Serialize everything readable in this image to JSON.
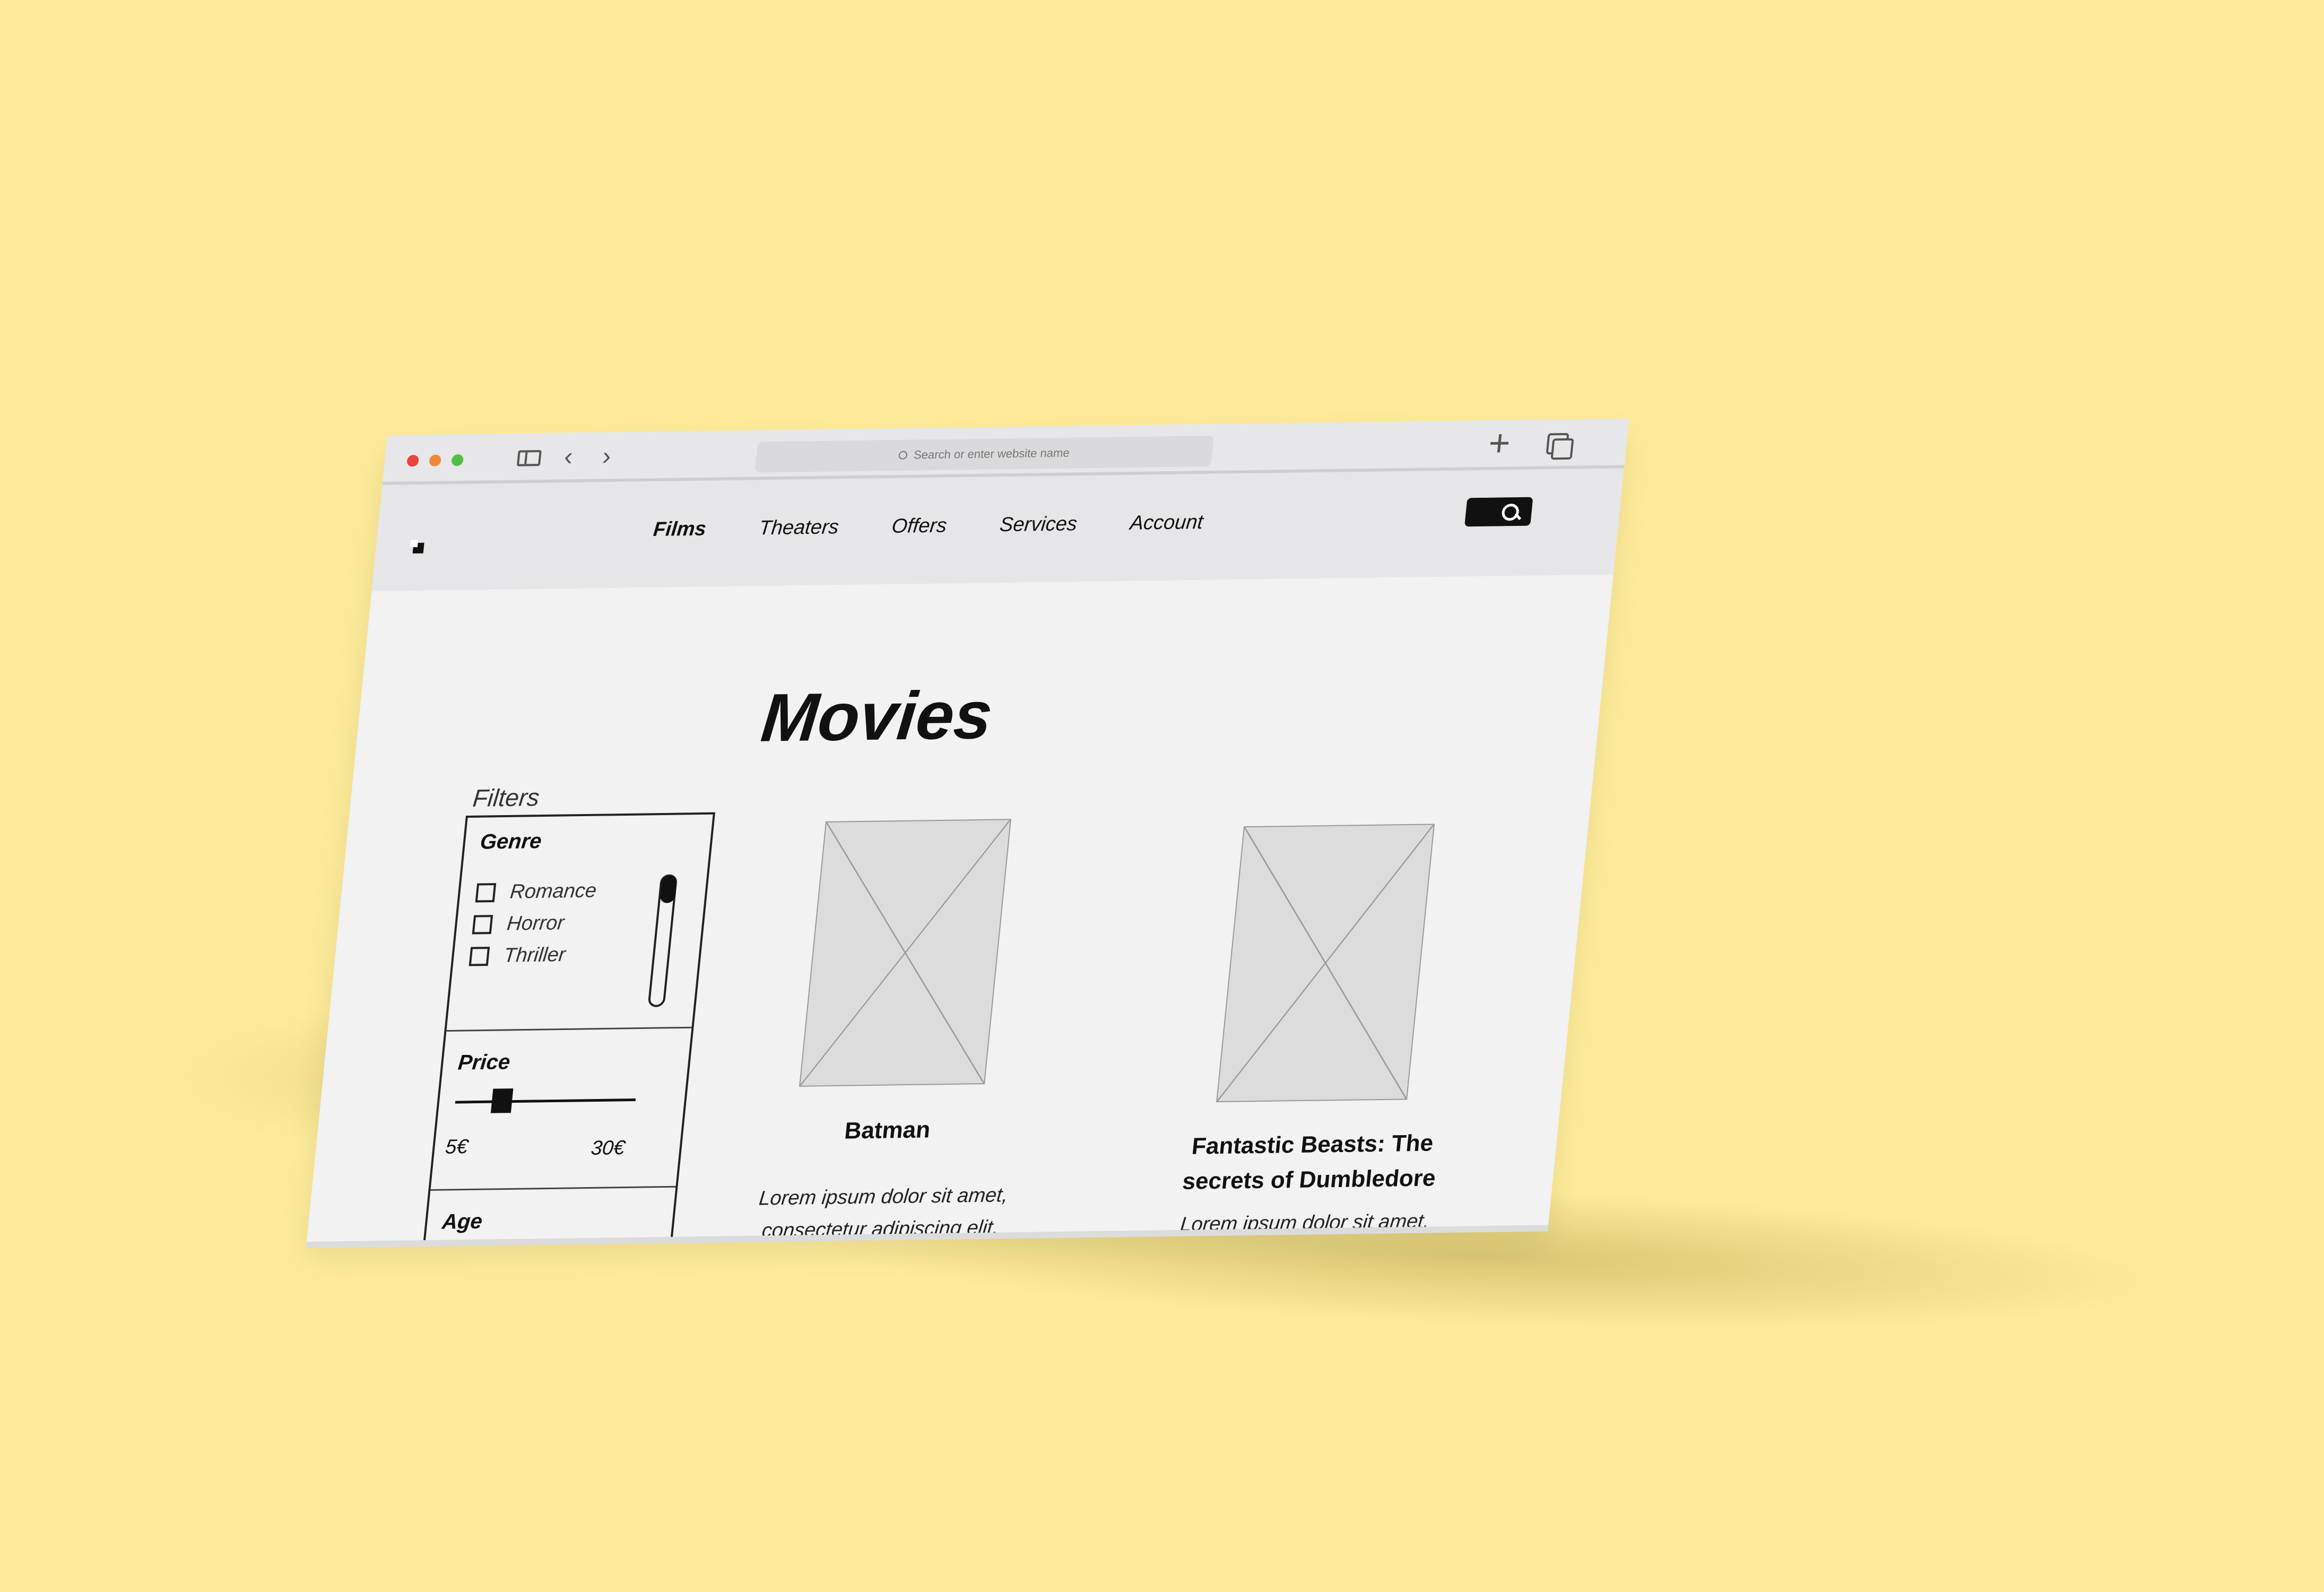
{
  "browser": {
    "address_placeholder": "Search or enter website name"
  },
  "site": {
    "nav": [
      "Films",
      "Theaters",
      "Offers",
      "Services",
      "Account"
    ],
    "active_nav": "Films"
  },
  "page": {
    "title": "Movies"
  },
  "filters": {
    "label": "Filters",
    "genre": {
      "heading": "Genre",
      "options": [
        "Romance",
        "Horror",
        "Thriller"
      ]
    },
    "price": {
      "heading": "Price",
      "min_label": "5€",
      "max_label": "30€",
      "handle_fraction": 0.2
    },
    "age": {
      "heading": "Age"
    }
  },
  "movies": [
    {
      "title": "Batman",
      "description": "Lorem ipsum dolor sit amet, consectetur adipiscing elit."
    },
    {
      "title": "Fantastic Beasts: The secrets of Dumbledore",
      "description": "Lorem ipsum dolor sit amet, consectetur adipiscing elit."
    }
  ],
  "colors": {
    "background": "#fdeb9a",
    "ink": "#111111",
    "chrome": "#e7e7e9"
  }
}
